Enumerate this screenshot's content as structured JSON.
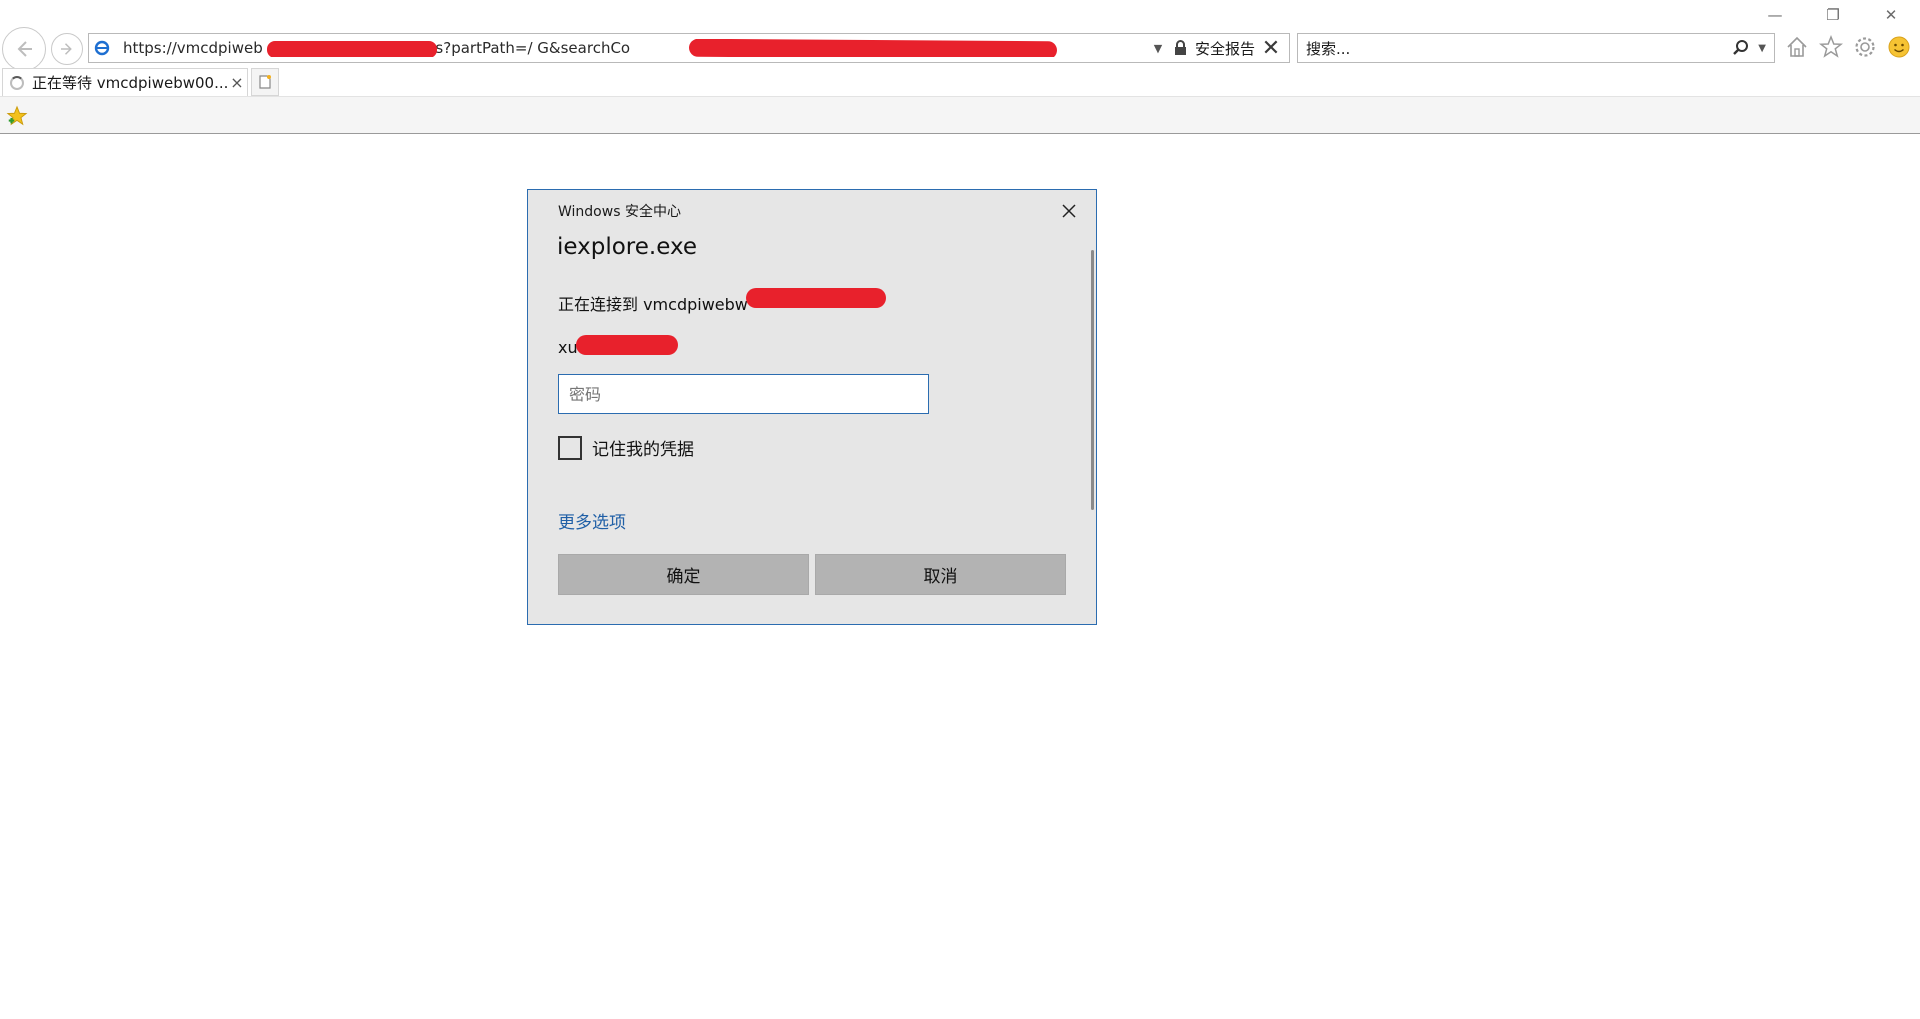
{
  "window": {
    "minimize_glyph": "—",
    "restore_glyph": "❐",
    "close_glyph": "✕"
  },
  "address_bar": {
    "url_visible": "https://vmcdpiweb                                        dataServiceRest/values?partPath=/                                                                                                  G&searchCo",
    "security_report_label": "安全报告"
  },
  "search": {
    "placeholder": "搜索..."
  },
  "tab": {
    "title": "正在等待 vmcdpiwebw00...",
    "close_glyph": "×"
  },
  "toolbar_icons": [
    "home-icon",
    "favorites-star-icon",
    "gear-icon",
    "smiley-feedback-icon"
  ],
  "dialog": {
    "title": "Windows 安全中心",
    "app_name": "iexplore.exe",
    "connecting_text": "正在连接到 vmcdpiwebw",
    "username_prefix": "xu",
    "password_placeholder": "密码",
    "remember_label": "记住我的凭据",
    "more_options_label": "更多选项",
    "ok_label": "确定",
    "cancel_label": "取消"
  },
  "colors": {
    "accent_blue": "#2b6cb0",
    "link_blue": "#1f5fa6",
    "redaction_red": "#e8212c",
    "dialog_bg": "#e6e6e6",
    "button_gray": "#b3b3b3"
  }
}
